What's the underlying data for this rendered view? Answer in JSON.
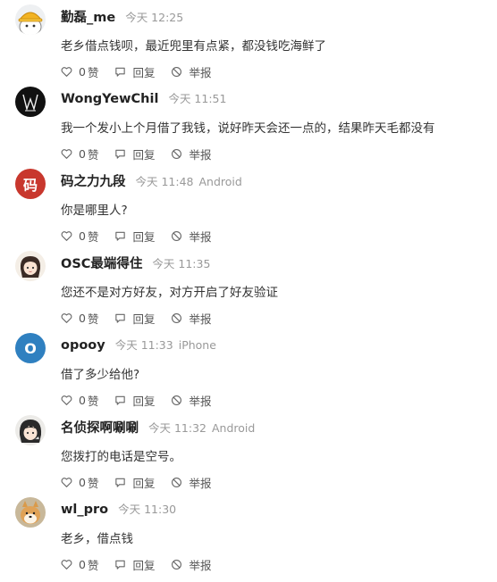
{
  "comments": [
    {
      "username": "勤磊_me",
      "time": "今天 12:25",
      "device": "",
      "content": "老乡借点钱呗，最近兜里有点紧，都没钱吃海鲜了",
      "like_count": "0",
      "like_label": "赞",
      "reply_label": "回复",
      "report_label": "举报",
      "avatar": {
        "type": "image",
        "letter": "",
        "color": ""
      }
    },
    {
      "username": "WongYewChil",
      "time": "今天 11:51",
      "device": "",
      "content": "我一个发小上个月借了我钱，说好昨天会还一点的，结果昨天毛都没有",
      "like_count": "0",
      "like_label": "赞",
      "reply_label": "回复",
      "report_label": "举报",
      "avatar": {
        "type": "image",
        "letter": "",
        "color": ""
      }
    },
    {
      "username": "码之力九段",
      "time": "今天 11:48",
      "device": "Android",
      "content": "你是哪里人?",
      "like_count": "0",
      "like_label": "赞",
      "reply_label": "回复",
      "report_label": "举报",
      "avatar": {
        "type": "letter",
        "letter": "码",
        "color": "#c8372d"
      }
    },
    {
      "username": "OSC最端得住",
      "time": "今天 11:35",
      "device": "",
      "content": "您还不是对方好友，对方开启了好友验证",
      "like_count": "0",
      "like_label": "赞",
      "reply_label": "回复",
      "report_label": "举报",
      "avatar": {
        "type": "image",
        "letter": "",
        "color": ""
      }
    },
    {
      "username": "opooy",
      "time": "今天 11:33",
      "device": "iPhone",
      "content": "借了多少给他?",
      "like_count": "0",
      "like_label": "赞",
      "reply_label": "回复",
      "report_label": "举报",
      "avatar": {
        "type": "letter",
        "letter": "O",
        "color": "#2f80c0"
      }
    },
    {
      "username": "名侦探啊唰唰",
      "time": "今天 11:32",
      "device": "Android",
      "content": "您拨打的电话是空号。",
      "like_count": "0",
      "like_label": "赞",
      "reply_label": "回复",
      "report_label": "举报",
      "avatar": {
        "type": "image",
        "letter": "",
        "color": ""
      }
    },
    {
      "username": "wl_pro",
      "time": "今天 11:30",
      "device": "",
      "content": "老乡，借点钱",
      "like_count": "0",
      "like_label": "赞",
      "reply_label": "回复",
      "report_label": "举报",
      "avatar": {
        "type": "image",
        "letter": "",
        "color": ""
      }
    }
  ]
}
